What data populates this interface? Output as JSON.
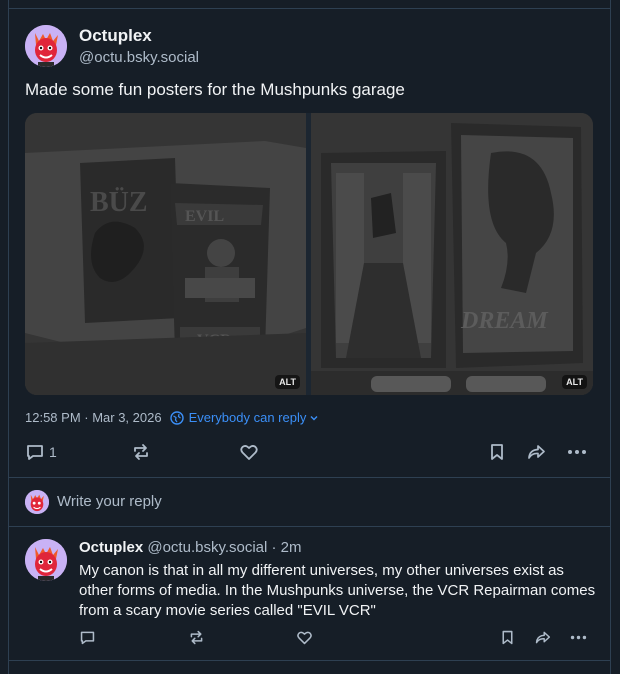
{
  "post": {
    "author_name": "Octuplex",
    "author_handle": "@octu.bsky.social",
    "text": "Made some fun posters for the Mushpunks garage",
    "images": [
      {
        "name": "evil-vcr-poster",
        "alt_badge": "ALT",
        "poster_text": [
          "BÜZ",
          "EVIL",
          "VCR"
        ]
      },
      {
        "name": "dream-poster",
        "alt_badge": "ALT",
        "poster_text": [
          "DREAM"
        ]
      }
    ],
    "timestamp": "12:58 PM · Mar 3, 2026",
    "reply_setting": "Everybody can reply",
    "reply_count": "1"
  },
  "composer": {
    "placeholder": "Write your reply"
  },
  "reply": {
    "author_name": "Octuplex",
    "author_handle_time": "@octu.bsky.social · 2m",
    "text": "My canon is that in all my different universes, my other universes exist as other forms of media. In the Mushpunks universe, the VCR Repairman comes from a scary movie series called \"EVIL VCR\""
  },
  "colors": {
    "background": "#161e27",
    "border": "#2e4052",
    "text": "#f1f3f5",
    "muted": "#aebbc9",
    "accent": "#3b8ff7",
    "avatar_bg": "#c9b2f5",
    "avatar_face": "#e0263a"
  }
}
